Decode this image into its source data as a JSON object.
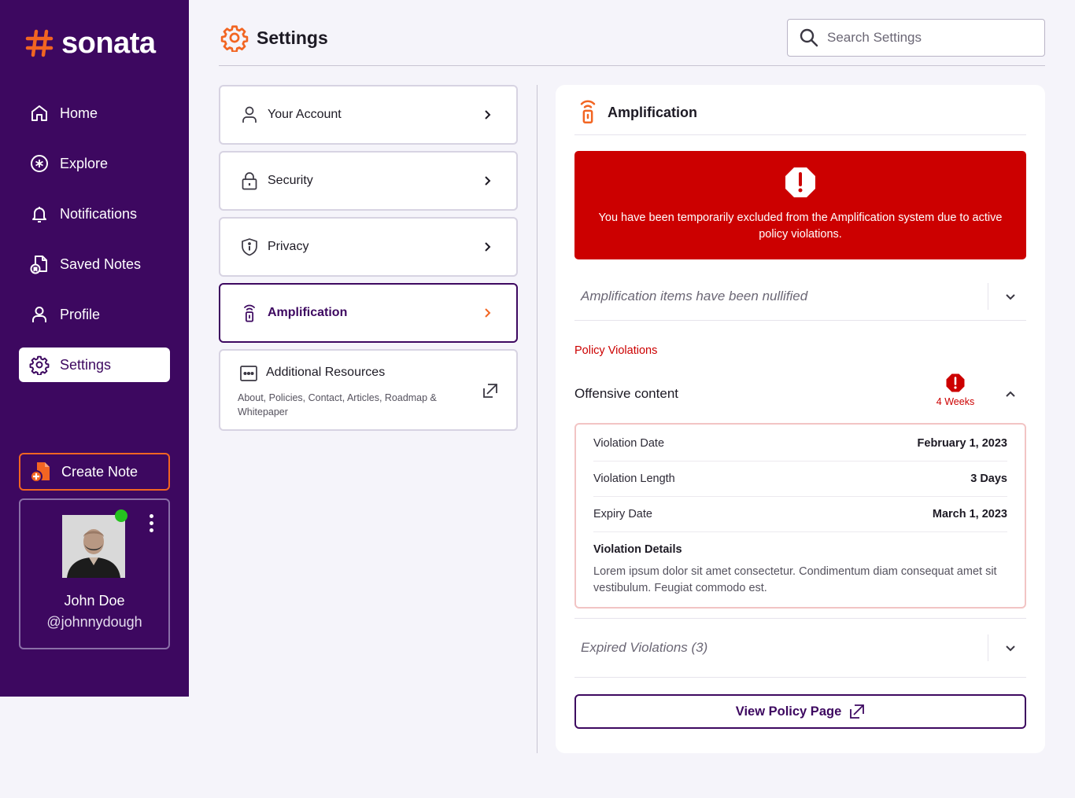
{
  "brand": {
    "name": "sonata",
    "accent": "#f26522",
    "primary": "#3d0860",
    "danger": "#cc0000"
  },
  "sidebar": {
    "items": [
      {
        "label": "Home",
        "icon": "home-icon"
      },
      {
        "label": "Explore",
        "icon": "explore-icon"
      },
      {
        "label": "Notifications",
        "icon": "bell-icon"
      },
      {
        "label": "Saved Notes",
        "icon": "saved-notes-icon"
      },
      {
        "label": "Profile",
        "icon": "person-icon"
      },
      {
        "label": "Settings",
        "icon": "gear-icon",
        "active": true
      }
    ],
    "create_note": "Create Note",
    "user": {
      "name": "John Doe",
      "handle": "@johnnydough",
      "online": true
    }
  },
  "header": {
    "title": "Settings",
    "search_placeholder": "Search Settings"
  },
  "settings_menu": {
    "items": [
      {
        "label": "Your Account",
        "icon": "person-icon"
      },
      {
        "label": "Security",
        "icon": "lock-icon"
      },
      {
        "label": "Privacy",
        "icon": "shield-icon"
      },
      {
        "label": "Amplification",
        "icon": "amplification-icon",
        "active": true
      }
    ],
    "resources": {
      "label": "Additional Resources",
      "description": "About, Policies, Contact, Articles, Roadmap & Whitepaper"
    }
  },
  "detail": {
    "title": "Amplification",
    "alert": "You have been temporarily excluded from the Amplification system due to active policy violations.",
    "nullified_label": "Amplification items have been nullified",
    "policy_violations_label": "Policy Violations",
    "violation": {
      "title": "Offensive content",
      "badge": "4 Weeks",
      "rows": [
        {
          "key": "Violation Date",
          "value": "February 1, 2023"
        },
        {
          "key": "Violation Length",
          "value": "3 Days"
        },
        {
          "key": "Expiry Date",
          "value": "March 1, 2023"
        }
      ],
      "details_title": "Violation Details",
      "details_text": "Lorem ipsum dolor sit amet consectetur. Condimentum diam consequat amet sit vestibulum. Feugiat commodo est."
    },
    "expired_label": "Expired Violations (3)",
    "view_policy": "View Policy Page"
  }
}
